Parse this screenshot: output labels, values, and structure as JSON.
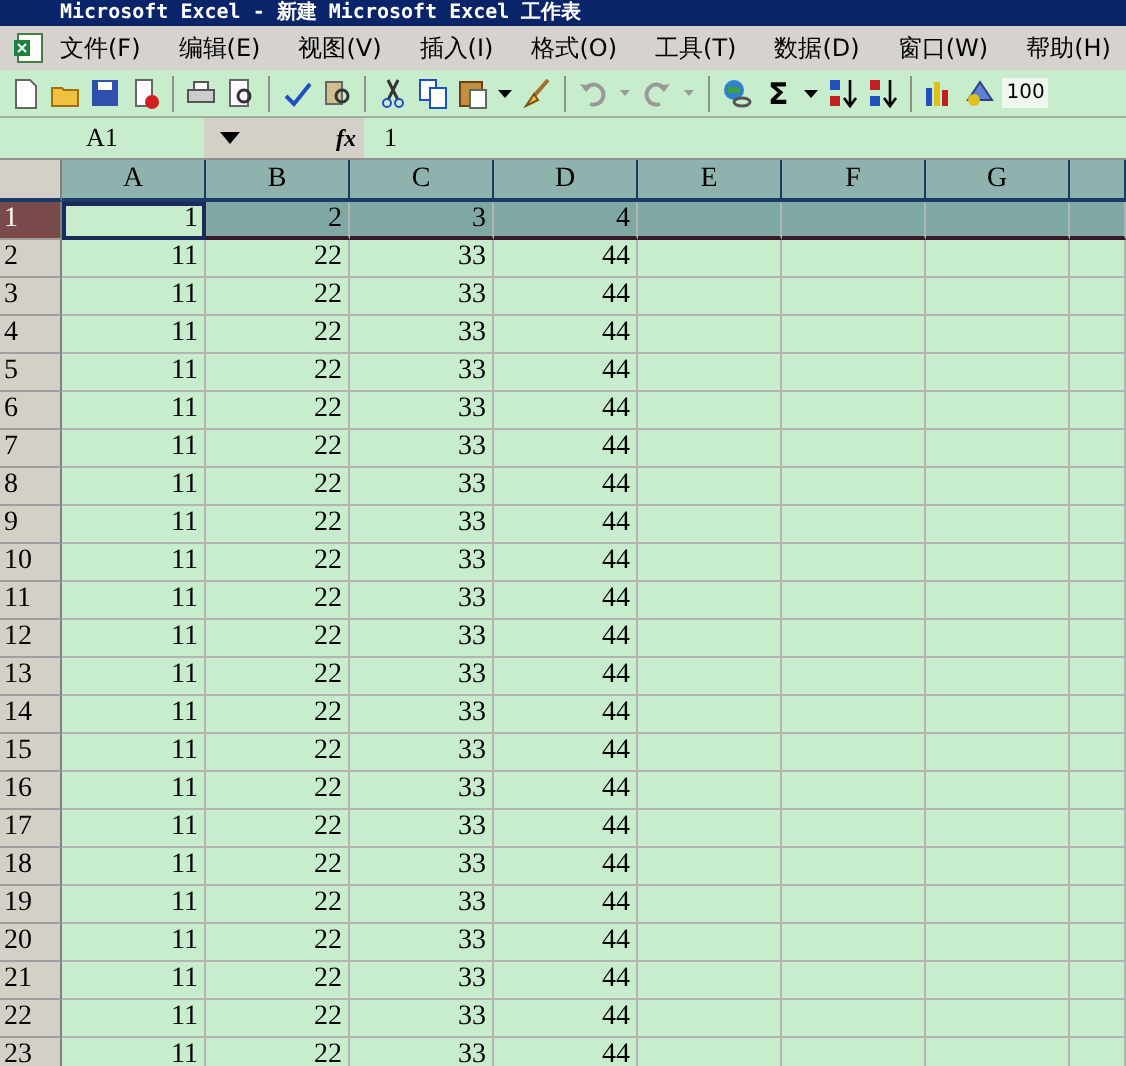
{
  "window": {
    "title": "Microsoft Excel - 新建 Microsoft Excel 工作表"
  },
  "menu": [
    "文件(F)",
    "编辑(E)",
    "视图(V)",
    "插入(I)",
    "格式(O)",
    "工具(T)",
    "数据(D)",
    "窗口(W)",
    "帮助(H)"
  ],
  "toolbar": {
    "sum_label": "Σ",
    "zoom": "100"
  },
  "formula_bar": {
    "name_box": "A1",
    "fx": "fx",
    "value": "1"
  },
  "columns": [
    "A",
    "B",
    "C",
    "D",
    "E",
    "F",
    "G"
  ],
  "rows": [
    {
      "header": "1",
      "selected": true,
      "cells": [
        "1",
        "2",
        "3",
        "4"
      ]
    },
    {
      "header": "2",
      "selected": false,
      "cells": [
        "11",
        "22",
        "33",
        "44"
      ]
    },
    {
      "header": "3",
      "selected": false,
      "cells": [
        "11",
        "22",
        "33",
        "44"
      ]
    },
    {
      "header": "4",
      "selected": false,
      "cells": [
        "11",
        "22",
        "33",
        "44"
      ]
    },
    {
      "header": "5",
      "selected": false,
      "cells": [
        "11",
        "22",
        "33",
        "44"
      ]
    },
    {
      "header": "6",
      "selected": false,
      "cells": [
        "11",
        "22",
        "33",
        "44"
      ]
    },
    {
      "header": "7",
      "selected": false,
      "cells": [
        "11",
        "22",
        "33",
        "44"
      ]
    },
    {
      "header": "8",
      "selected": false,
      "cells": [
        "11",
        "22",
        "33",
        "44"
      ]
    },
    {
      "header": "9",
      "selected": false,
      "cells": [
        "11",
        "22",
        "33",
        "44"
      ]
    },
    {
      "header": "10",
      "selected": false,
      "cells": [
        "11",
        "22",
        "33",
        "44"
      ]
    },
    {
      "header": "11",
      "selected": false,
      "cells": [
        "11",
        "22",
        "33",
        "44"
      ]
    },
    {
      "header": "12",
      "selected": false,
      "cells": [
        "11",
        "22",
        "33",
        "44"
      ]
    },
    {
      "header": "13",
      "selected": false,
      "cells": [
        "11",
        "22",
        "33",
        "44"
      ]
    },
    {
      "header": "14",
      "selected": false,
      "cells": [
        "11",
        "22",
        "33",
        "44"
      ]
    },
    {
      "header": "15",
      "selected": false,
      "cells": [
        "11",
        "22",
        "33",
        "44"
      ]
    },
    {
      "header": "16",
      "selected": false,
      "cells": [
        "11",
        "22",
        "33",
        "44"
      ]
    },
    {
      "header": "17",
      "selected": false,
      "cells": [
        "11",
        "22",
        "33",
        "44"
      ]
    },
    {
      "header": "18",
      "selected": false,
      "cells": [
        "11",
        "22",
        "33",
        "44"
      ]
    },
    {
      "header": "19",
      "selected": false,
      "cells": [
        "11",
        "22",
        "33",
        "44"
      ]
    },
    {
      "header": "20",
      "selected": false,
      "cells": [
        "11",
        "22",
        "33",
        "44"
      ]
    },
    {
      "header": "21",
      "selected": false,
      "cells": [
        "11",
        "22",
        "33",
        "44"
      ]
    },
    {
      "header": "22",
      "selected": false,
      "cells": [
        "11",
        "22",
        "33",
        "44"
      ]
    },
    {
      "header": "23",
      "selected": false,
      "cells": [
        "11",
        "22",
        "33",
        "44"
      ]
    }
  ]
}
